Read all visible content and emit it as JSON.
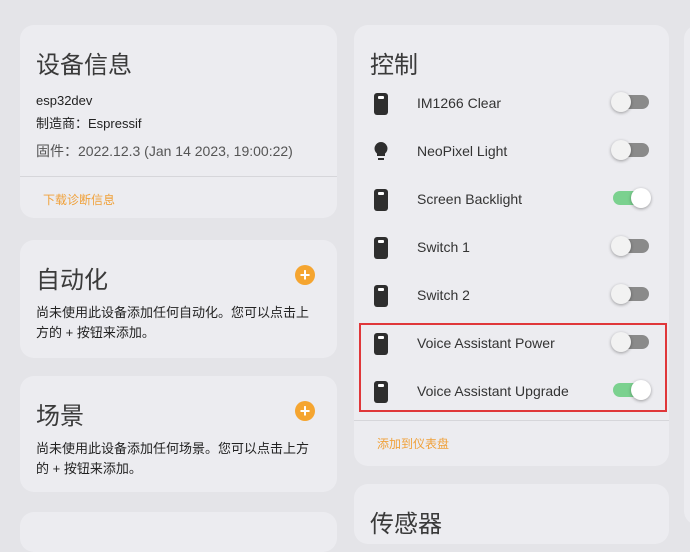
{
  "device_info": {
    "title": "设备信息",
    "model": "esp32dev",
    "manufacturer": "制造商：Espressif",
    "firmware": "固件：2022.12.3 (Jan 14 2023, 19:00:22)",
    "download_link": "下载诊断信息"
  },
  "automation": {
    "title": "自动化",
    "text": "尚未使用此设备添加任何自动化。您可以点击上方的 + 按钮来添加。"
  },
  "scene": {
    "title": "场景",
    "text": "尚未使用此设备添加任何场景。您可以点击上方的 + 按钮来添加。"
  },
  "controls": {
    "title": "控制",
    "add_link": "添加到仪表盘",
    "items": [
      {
        "label": "IM1266 Clear",
        "icon": "switch-icon",
        "on": false
      },
      {
        "label": "NeoPixel Light",
        "icon": "lightbulb-icon",
        "on": false
      },
      {
        "label": "Screen Backlight",
        "icon": "switch-icon",
        "on": true
      },
      {
        "label": "Switch 1",
        "icon": "switch-icon",
        "on": false
      },
      {
        "label": "Switch 2",
        "icon": "switch-icon",
        "on": false
      },
      {
        "label": "Voice Assistant Power",
        "icon": "switch-icon",
        "on": false
      },
      {
        "label": "Voice Assistant Upgrade",
        "icon": "switch-icon",
        "on": true
      }
    ]
  },
  "sensors": {
    "title": "传感器"
  },
  "colors": {
    "accent": "#f0a13a",
    "toggle_on": "#7bd18f",
    "highlight": "#e0373a"
  }
}
